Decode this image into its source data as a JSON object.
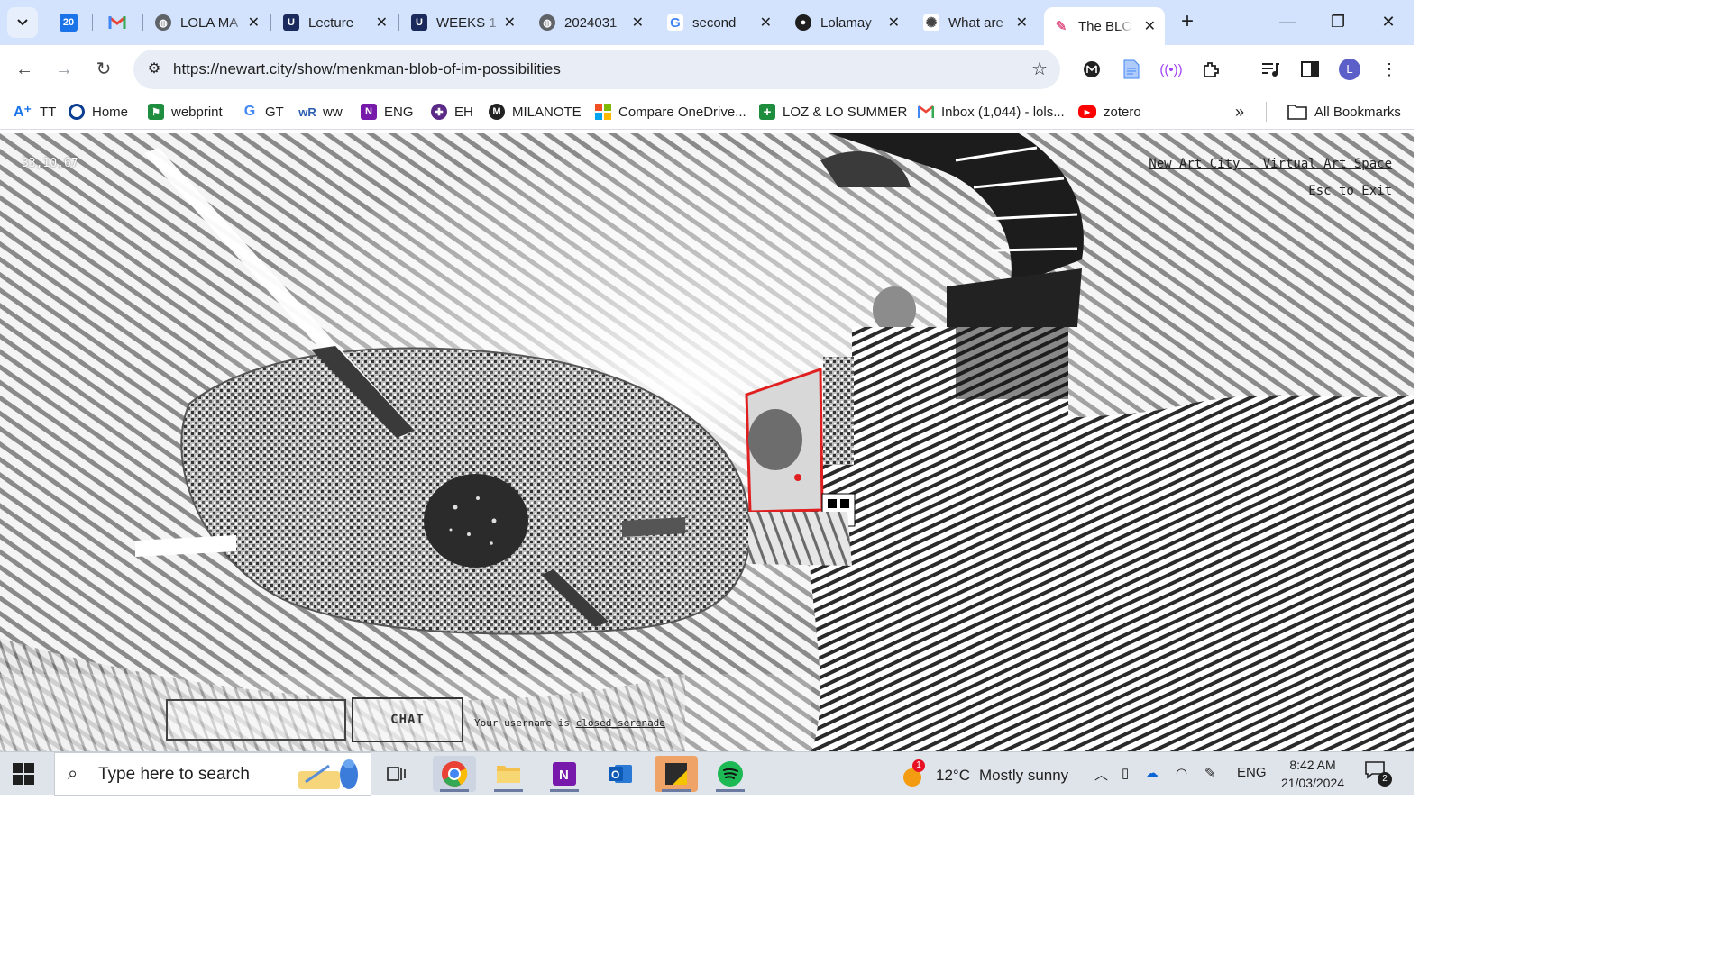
{
  "browser": {
    "tabs": [
      {
        "title": "",
        "favicon": "calendar-icon",
        "color": "#1a73e8"
      },
      {
        "title": "",
        "favicon": "gmail-icon",
        "color": "#ea4335"
      },
      {
        "title": "LOLA MA",
        "favicon": "globe-icon"
      },
      {
        "title": "Lecture",
        "favicon": "university-icon"
      },
      {
        "title": "WEEKS 1",
        "favicon": "university-icon"
      },
      {
        "title": "2024031",
        "favicon": "globe-icon"
      },
      {
        "title": "second",
        "favicon": "google-icon"
      },
      {
        "title": "Lolamay",
        "favicon": "github-icon"
      },
      {
        "title": "What are",
        "favicon": "ai-icon"
      },
      {
        "title": "The BLO",
        "favicon": "newart-icon",
        "active": true
      }
    ],
    "calendar_day": "20",
    "url": "https://newart.city/show/menkman-blob-of-im-possibilities",
    "profile_initial": "L"
  },
  "bookmarks": [
    {
      "label": "TT",
      "icon": "text-icon",
      "color": "#1a73e8"
    },
    {
      "label": "Home",
      "icon": "circle-icon",
      "color": "#0b3d91"
    },
    {
      "label": "webprint",
      "icon": "flag-icon",
      "color": "#1e8e3e"
    },
    {
      "label": "GT",
      "icon": "google-icon",
      "color": "#4285f4"
    },
    {
      "label": "ww",
      "icon": "wordreference-icon",
      "color": "#2a5db0"
    },
    {
      "label": "ENG",
      "icon": "onenote-icon",
      "color": "#7719aa"
    },
    {
      "label": "EH",
      "icon": "eh-icon",
      "color": "#5b2a86"
    },
    {
      "label": "MILANOTE",
      "icon": "milanote-icon",
      "color": "#222222"
    },
    {
      "label": "Compare OneDrive...",
      "icon": "microsoft-icon",
      "color": "#f25022"
    },
    {
      "label": "LOZ & LO SUMMER",
      "icon": "plus-icon",
      "color": "#1e8e3e"
    },
    {
      "label": "Inbox (1,044) - lols...",
      "icon": "gmail-icon",
      "color": "#ea4335"
    },
    {
      "label": "zotero",
      "icon": "youtube-icon",
      "color": "#ff0000"
    }
  ],
  "all_bookmarks_label": "All Bookmarks",
  "scene": {
    "coords": "33,10,67",
    "site_title": "New Art City - Virtual Art Space",
    "esc_hint": "Esc to Exit",
    "chat_button": "CHAT",
    "username_prefix": "Your username is",
    "username": "closed_serenade"
  },
  "taskbar": {
    "search_placeholder": "Type here to search",
    "weather_temp": "12°C",
    "weather_desc": "Mostly sunny",
    "weather_badge": "1",
    "language": "ENG",
    "time": "8:42 AM",
    "date": "21/03/2024",
    "notification_count": "2"
  }
}
